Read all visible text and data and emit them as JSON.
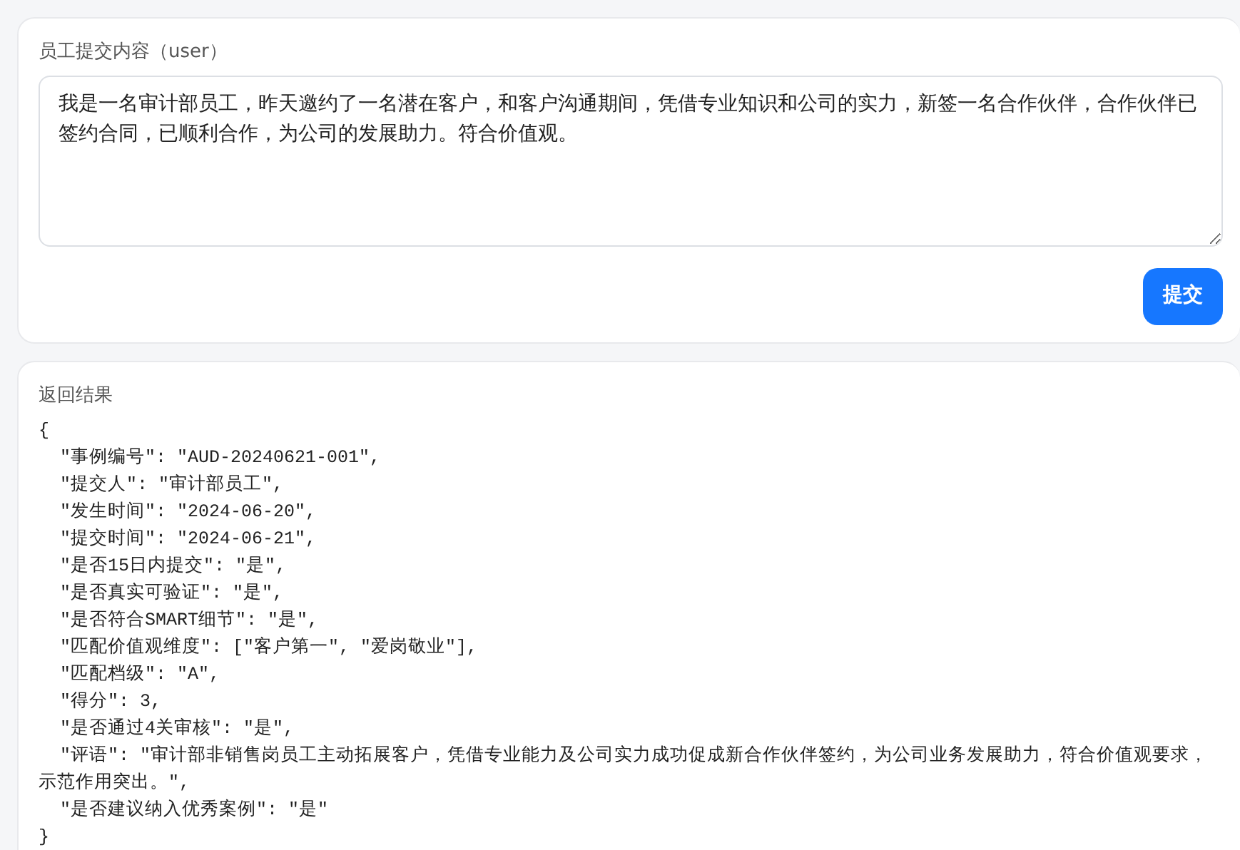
{
  "submit_form": {
    "label": "员工提交内容（user）",
    "content": "我是一名审计部员工，昨天邀约了一名潜在客户，和客户沟通期间，凭借专业知识和公司的实力，新签一名合作伙伴，合作伙伴已签约合同，已顺利合作，为公司的发展助力。符合价值观。",
    "button": "提交"
  },
  "result": {
    "label": "返回结果",
    "text": "{\n  \"事例编号\": \"AUD-20240621-001\",\n  \"提交人\": \"审计部员工\",\n  \"发生时间\": \"2024-06-20\",\n  \"提交时间\": \"2024-06-21\",\n  \"是否15日内提交\": \"是\",\n  \"是否真实可验证\": \"是\",\n  \"是否符合SMART细节\": \"是\",\n  \"匹配价值观维度\": [\"客户第一\", \"爱岗敬业\"],\n  \"匹配档级\": \"A\",\n  \"得分\": 3,\n  \"是否通过4关审核\": \"是\",\n  \"评语\": \"审计部非销售岗员工主动拓展客户，凭借专业能力及公司实力成功促成新合作伙伴签约，为公司业务发展助力，符合价值观要求，示范作用突出。\",\n  \"是否建议纳入优秀案例\": \"是\"\n}"
  }
}
